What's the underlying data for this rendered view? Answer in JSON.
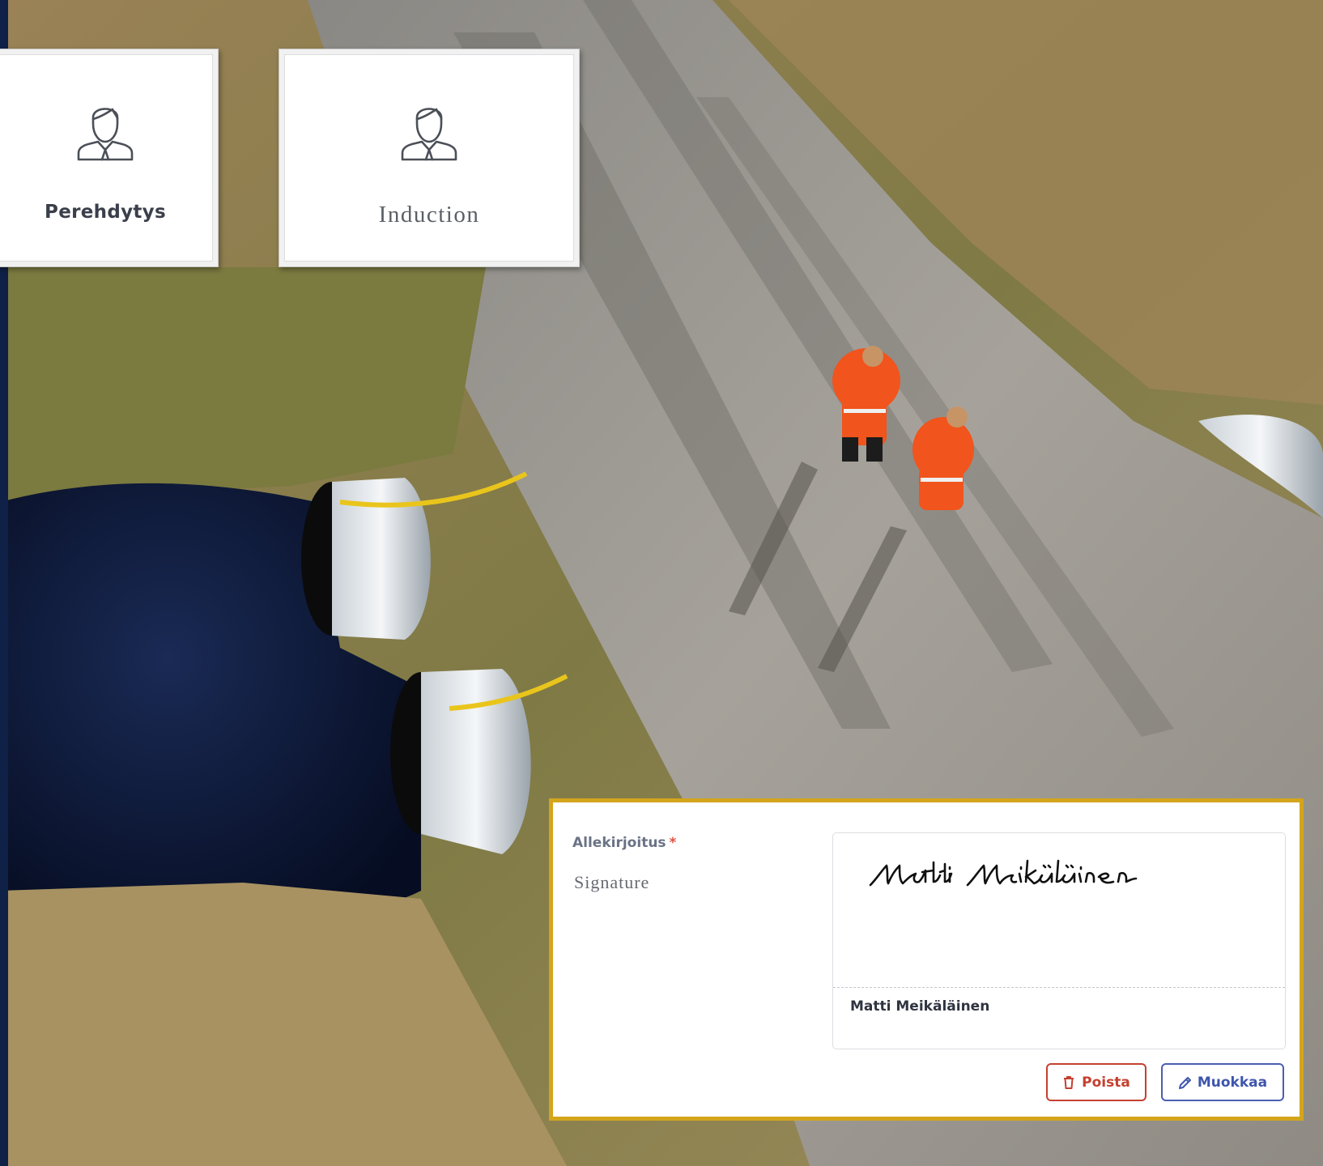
{
  "tiles": [
    {
      "label": "Perehdytys",
      "icon": "person-icon"
    },
    {
      "label": "Induction",
      "icon": "person-icon"
    }
  ],
  "signature": {
    "label": "Allekirjoitus",
    "required_mark": "*",
    "subtitle": "Signature",
    "signer_name": "Matti Meikäläinen",
    "handwritten": "Matti Meikäläinen",
    "buttons": {
      "delete": "Poista",
      "edit": "Muokkaa"
    }
  },
  "colors": {
    "card_border": "#d4a51c",
    "delete": "#c4412f",
    "edit": "#3e56ad",
    "required": "#e25141"
  }
}
